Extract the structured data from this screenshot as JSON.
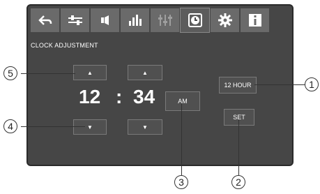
{
  "toolbar": {
    "tabs": [
      {
        "name": "back-icon"
      },
      {
        "name": "sliders-icon"
      },
      {
        "name": "speaker-icon"
      },
      {
        "name": "equalizer-icon"
      },
      {
        "name": "faders-icon"
      },
      {
        "name": "clock-icon"
      },
      {
        "name": "gear-icon"
      },
      {
        "name": "info-icon"
      }
    ]
  },
  "screen_title": "CLOCK ADJUSTMENT",
  "clock": {
    "hour": "12",
    "separator": ":",
    "minute": "34",
    "ampm": "AM",
    "up_arrow": "▲",
    "down_arrow": "▼"
  },
  "buttons": {
    "hour_format": "12 HOUR",
    "set": "SET"
  },
  "callouts": {
    "c1": "1",
    "c2": "2",
    "c3": "3",
    "c4": "4",
    "c5": "5"
  }
}
